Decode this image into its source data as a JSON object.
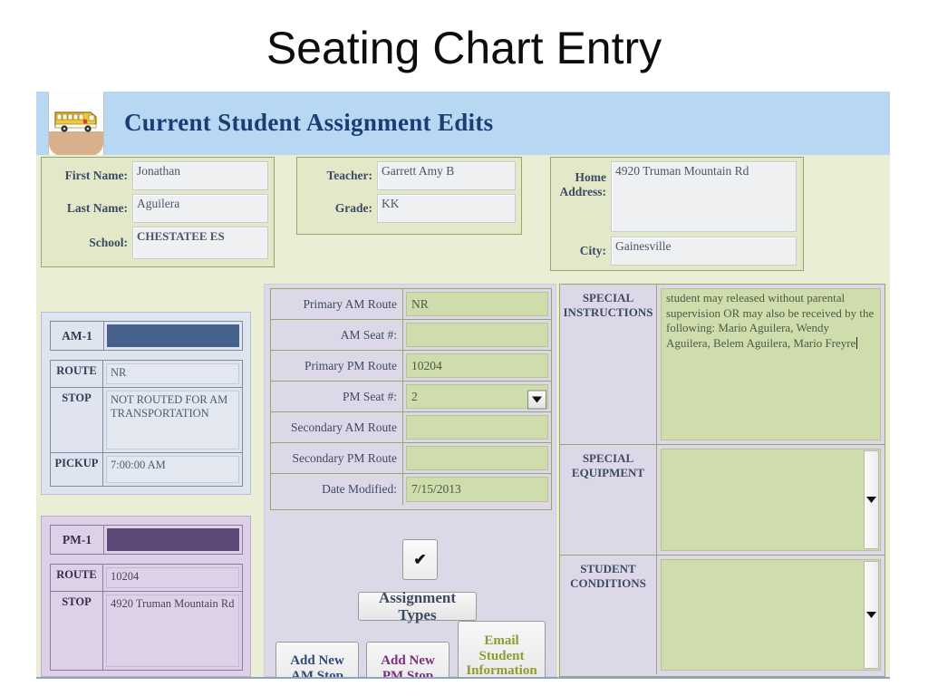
{
  "slide": {
    "title": "Seating Chart Entry"
  },
  "banner": {
    "title": "Current Student Assignment Edits",
    "icon": "school-bus-icon",
    "bg_color": "#b7d7f3",
    "text_color": "#1b3d73"
  },
  "student": {
    "fields": [
      {
        "label": "First Name:",
        "value": "Jonathan"
      },
      {
        "label": "Last Name:",
        "value": "Aguilera"
      },
      {
        "label": "School:",
        "value": "CHESTATEE ES"
      }
    ]
  },
  "school_info": {
    "fields": [
      {
        "label": "Teacher:",
        "value": "Garrett Amy B"
      },
      {
        "label": "Grade:",
        "value": "KK"
      }
    ]
  },
  "address_info": {
    "fields": [
      {
        "label": "Home Address:",
        "label_line1": "Home",
        "label_line2": "Address:",
        "value": "4920 Truman Mountain Rd"
      },
      {
        "label": "City:",
        "value": "Gainesville"
      }
    ]
  },
  "am_card": {
    "tag": "AM-1",
    "bar_color": "#45618c",
    "rows": [
      {
        "key": "ROUTE",
        "value": "NR"
      },
      {
        "key": "STOP",
        "value": "NOT ROUTED FOR AM TRANSPORTATION"
      },
      {
        "key": "PICKUP",
        "value": "7:00:00 AM"
      }
    ]
  },
  "pm_card": {
    "tag": "PM-1",
    "bar_color": "#5d4977",
    "rows": [
      {
        "key": "ROUTE",
        "value": "10204"
      },
      {
        "key": "STOP",
        "value": "4920 Truman Mountain Rd"
      }
    ]
  },
  "route_form": {
    "rows": [
      {
        "label": "Primary AM Route",
        "value": "NR",
        "combo": true
      },
      {
        "label": "AM Seat #:",
        "value": "",
        "combo": false
      },
      {
        "label": "Primary PM Route",
        "value": "10204",
        "combo": true
      },
      {
        "label": "PM Seat #:",
        "value": "2",
        "combo": false
      },
      {
        "label": "Secondary AM Route",
        "value": "",
        "combo": true
      },
      {
        "label": "Secondary PM Route",
        "value": "",
        "combo": true
      },
      {
        "label": "Date Modified:",
        "value": "7/15/2013",
        "combo": false
      }
    ]
  },
  "buttons": {
    "check": "✔",
    "assignment_types": "Assignment Types",
    "add_new_am_stop": "Add New AM Stop",
    "add_new_am_stop_l1": "Add New",
    "add_new_am_stop_l2": "AM Stop",
    "add_new_pm_stop": "Add New PM Stop",
    "add_new_pm_stop_l1": "Add New",
    "add_new_pm_stop_l2": "PM Stop",
    "email_student_information": "Email Student Information",
    "email_l1": "Email",
    "email_l2": "Student",
    "email_l3": "Information"
  },
  "notes_panel": {
    "rows": [
      {
        "label_line1": "SPECIAL",
        "label_line2": "INSTRUCTIONS",
        "value": "student may released without parental supervision OR may also be received by the following: Mario Aguilera, Wendy Aguilera, Belem Aguilera, Mario Freyre",
        "has_scrollbar": false,
        "has_caret": true
      },
      {
        "label_line1": "SPECIAL",
        "label_line2": "EQUIPMENT",
        "value": "",
        "has_scrollbar": true,
        "has_caret": false
      },
      {
        "label_line1": "STUDENT",
        "label_line2": "CONDITIONS",
        "value": "",
        "has_scrollbar": true,
        "has_caret": false
      }
    ]
  },
  "colors": {
    "form_bg": "#e9eed5",
    "group_bg": "#e2e8c8",
    "group_border": "#93a86a",
    "lavender": "#dcd8e8",
    "field_green": "#cfdcab",
    "label_blue": "#3d4a63"
  }
}
